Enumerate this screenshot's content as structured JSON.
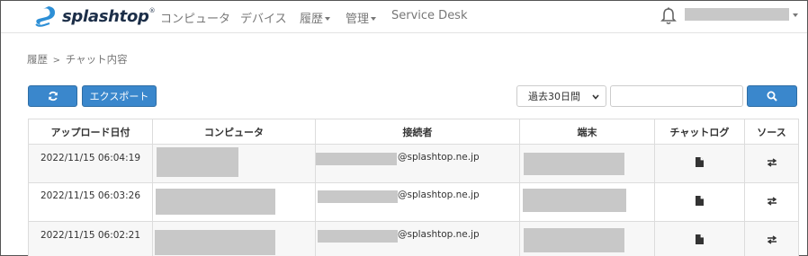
{
  "brand": {
    "name": "splashtop",
    "reg": "®"
  },
  "nav": {
    "computers": "コンピュータ",
    "devices": "デバイス",
    "history": "履歴",
    "management": "管理",
    "service_desk": "Service Desk"
  },
  "breadcrumb": {
    "parent": "履歴",
    "separator": ">",
    "current": "チャット内容"
  },
  "toolbar": {
    "export_label": "エクスポート",
    "period_value": "過去30日間",
    "search_value": ""
  },
  "table": {
    "headers": [
      "アップロード日付",
      "コンピュータ",
      "接続者",
      "端末",
      "チャットログ",
      "ソース"
    ],
    "rows": [
      {
        "upload_date": "2022/11/15 06:04:19",
        "email_domain": "@splashtop.ne.jp"
      },
      {
        "upload_date": "2022/11/15 06:03:26",
        "email_domain": "@splashtop.ne.jp"
      },
      {
        "upload_date": "2022/11/15 06:02:21",
        "email_domain": "@splashtop.ne.jp"
      }
    ]
  },
  "colors": {
    "primary": "#3a87cc",
    "brand_dark": "#1c2e48",
    "redacted": "#c8c8c8"
  },
  "icons": [
    "splashtop-logo",
    "bell-icon",
    "refresh-icon",
    "search-icon",
    "file-icon",
    "transfer-icon"
  ]
}
